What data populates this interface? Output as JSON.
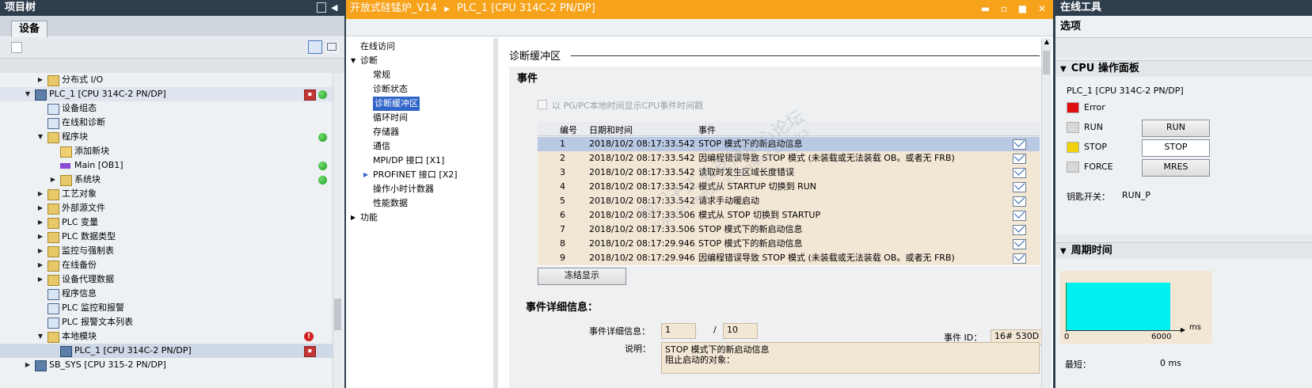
{
  "project_tree": {
    "title": "项目树",
    "tab_label": "设备",
    "items": [
      {
        "label": "分布式 I/O",
        "indent": 1,
        "expander": "right",
        "icon": "folder-icon"
      },
      {
        "label": "PLC_1 [CPU 314C-2 PN/DP]",
        "indent": 0,
        "expander": "down",
        "icon": "plc-icon",
        "selected": true,
        "badge": "plc",
        "status": "ok"
      },
      {
        "label": "设备组态",
        "indent": 1,
        "expander": "",
        "icon": "device-config-icon"
      },
      {
        "label": "在线和诊断",
        "indent": 1,
        "expander": "",
        "icon": "diagnostics-icon"
      },
      {
        "label": "程序块",
        "indent": 1,
        "expander": "down",
        "icon": "folder-icon",
        "status": "ok"
      },
      {
        "label": "添加新块",
        "indent": 2,
        "expander": "",
        "icon": "add-block-icon"
      },
      {
        "label": "Main [OB1]",
        "indent": 2,
        "expander": "",
        "icon": "ob-block-icon",
        "status": "ok"
      },
      {
        "label": "系统块",
        "indent": 2,
        "expander": "right",
        "icon": "folder-icon",
        "status": "ok"
      },
      {
        "label": "工艺对象",
        "indent": 1,
        "expander": "right",
        "icon": "folder-icon"
      },
      {
        "label": "外部源文件",
        "indent": 1,
        "expander": "right",
        "icon": "folder-icon"
      },
      {
        "label": "PLC 变量",
        "indent": 1,
        "expander": "right",
        "icon": "folder-icon"
      },
      {
        "label": "PLC 数据类型",
        "indent": 1,
        "expander": "right",
        "icon": "folder-icon"
      },
      {
        "label": "监控与强制表",
        "indent": 1,
        "expander": "right",
        "icon": "folder-icon"
      },
      {
        "label": "在线备份",
        "indent": 1,
        "expander": "right",
        "icon": "folder-icon"
      },
      {
        "label": "设备代理数据",
        "indent": 1,
        "expander": "right",
        "icon": "folder-icon"
      },
      {
        "label": "程序信息",
        "indent": 1,
        "expander": "",
        "icon": "program-info-icon"
      },
      {
        "label": "PLC 监控和报警",
        "indent": 1,
        "expander": "",
        "icon": "alarm-icon"
      },
      {
        "label": "PLC 报警文本列表",
        "indent": 1,
        "expander": "",
        "icon": "text-list-icon"
      },
      {
        "label": "本地模块",
        "indent": 1,
        "expander": "down",
        "icon": "folder-icon",
        "status": "error"
      },
      {
        "label": "PLC_1 [CPU 314C-2 PN/DP]",
        "indent": 2,
        "expander": "",
        "icon": "plc-icon",
        "selected": true,
        "badge": "plc"
      },
      {
        "label": "SB_SYS [CPU 315-2 PN/DP]",
        "indent": 0,
        "expander": "right",
        "icon": "plc-icon"
      }
    ]
  },
  "editor": {
    "breadcrumb": [
      "开放式硅锰炉_V14",
      "PLC_1 [CPU 314C-2 PN/DP]"
    ],
    "nav": [
      {
        "label": "在线访问",
        "indent": 0,
        "expander": ""
      },
      {
        "label": "诊断",
        "indent": 0,
        "expander": "down"
      },
      {
        "label": "常规",
        "indent": 1,
        "expander": ""
      },
      {
        "label": "诊断状态",
        "indent": 1,
        "expander": ""
      },
      {
        "label": "诊断缓冲区",
        "indent": 1,
        "expander": "",
        "selected": true
      },
      {
        "label": "循环时间",
        "indent": 1,
        "expander": ""
      },
      {
        "label": "存储器",
        "indent": 1,
        "expander": ""
      },
      {
        "label": "通信",
        "indent": 1,
        "expander": ""
      },
      {
        "label": "MPI/DP 接口 [X1]",
        "indent": 1,
        "expander": ""
      },
      {
        "label": "PROFINET 接口 [X2]",
        "indent": 1,
        "expander": "right"
      },
      {
        "label": "操作小时计数器",
        "indent": 1,
        "expander": ""
      },
      {
        "label": "性能数据",
        "indent": 1,
        "expander": ""
      },
      {
        "label": "功能",
        "indent": 0,
        "expander": "right"
      }
    ],
    "section_title": "诊断缓冲区",
    "events_title": "事件",
    "checkbox_label": "以 PG/PC本地时间显示CPU事件时间戳",
    "table": {
      "headers": [
        "编号",
        "日期和时间",
        "事件"
      ],
      "rows": [
        {
          "no": "1",
          "datetime": "2018/10/2 08:17:33.542",
          "event": "STOP 模式下的新启动信息",
          "selected": true
        },
        {
          "no": "2",
          "datetime": "2018/10/2 08:17:33.542",
          "event": "因编程错误导致 STOP 模式 (未装载或无法装载 OB。或者无 FRB)"
        },
        {
          "no": "3",
          "datetime": "2018/10/2 08:17:33.542",
          "event": "读取时发生区域长度错误"
        },
        {
          "no": "4",
          "datetime": "2018/10/2 08:17:33.542",
          "event": "模式从 STARTUP 切换到 RUN"
        },
        {
          "no": "5",
          "datetime": "2018/10/2 08:17:33.542",
          "event": "请求手动暖启动"
        },
        {
          "no": "6",
          "datetime": "2018/10/2 08:17:33.506",
          "event": "模式从 STOP 切换到 STARTUP"
        },
        {
          "no": "7",
          "datetime": "2018/10/2 08:17:33.506",
          "event": "STOP 模式下的新启动信息"
        },
        {
          "no": "8",
          "datetime": "2018/10/2 08:17:29.946",
          "event": "STOP 模式下的新启动信息"
        },
        {
          "no": "9",
          "datetime": "2018/10/2 08:17:29.946",
          "event": "因编程错误导致 STOP 模式 (未装载或无法装载 OB。或者无 FRB)"
        }
      ]
    },
    "freeze_button": "冻结显示",
    "details_title": "事件详细信息：",
    "details_label": "事件详细信息：",
    "details_index": "1",
    "details_sep": "/",
    "details_total": "10",
    "event_id_label": "事件 ID：",
    "event_id_value": "16# 530D",
    "description_label": "说明：",
    "description_text": "STOP 模式下的新启动信息",
    "description_text2": "阻止启动的对象：",
    "watermark_line1": "西门子工业支持中心论坛",
    "watermark_line2": "support.industry.siemens.com/cs"
  },
  "online_tools": {
    "title": "在线工具",
    "options_label": "选项",
    "cpu_panel_title": "CPU 操作面板",
    "cpu_name": "PLC_1 [CPU 314C-2 PN/DP]",
    "leds": [
      {
        "label": "Error",
        "color": "#e01010"
      },
      {
        "label": "RUN",
        "color": "#d8d8d8",
        "button": "RUN"
      },
      {
        "label": "STOP",
        "color": "#f2d20a",
        "button": "STOP"
      },
      {
        "label": "FORCE",
        "color": "#d8d8d8",
        "button": "MRES"
      }
    ],
    "key_switch_label": "钥匙开关：",
    "key_switch_value": "RUN_P",
    "cycle_title": "周期时间",
    "cycle_chart": {
      "x_min": "0",
      "x_max": "6000",
      "unit": "ms"
    },
    "shortest_label": "最短：",
    "shortest_value": "0 ms"
  }
}
